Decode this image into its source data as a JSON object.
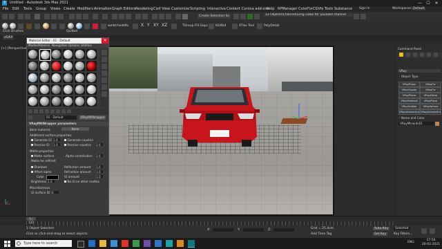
{
  "window": {
    "title": "Untitled - Autodesk 3ds Max 2021",
    "minimize": "—",
    "maximize": "☐",
    "close": "✕"
  },
  "menu": [
    "File",
    "Edit",
    "Tools",
    "Group",
    "Views",
    "Create",
    "Modifiers",
    "Animation",
    "Graph Editors",
    "Rendering",
    "Civil View",
    "Customize",
    "Scripting",
    "Interactive",
    "Content",
    "Corona add-ons",
    "Help",
    "RPManager",
    "ColorForCGVfx Tools",
    "Substance"
  ],
  "toolbar": {
    "selection_set": "Create Selection Se",
    "signin": "Sign In",
    "workspaces_label": "Workspaces:",
    "workspaces_value": "Default",
    "lineset_status": "Unsolved Camera Obj / Compressed",
    "lineset_info": "12 Objects\\Channel\\Long video for youtube channel",
    "view_label": "View",
    "click_brushes": "Click Brushes",
    "quilted": "Quilted",
    "rowby": "rowByAdd",
    "walkthrough": "walktrhee",
    "tilts": "tilts",
    "xyz": [
      "X",
      "Y",
      "XY",
      "XZ"
    ],
    "fill_gap": "Fill Gaps",
    "tgroup": "TGroup",
    "kill_label": "Kill/Kid",
    "camera_label": "Camera",
    "vray_label": "ATlas Tool",
    "polymodel": "PolyDetail",
    "texture": "Texture",
    "modeling": "Modeling",
    "freeform": "Freeform",
    "selection": "Selection",
    "object_paint": "Object Paint",
    "populate": "Populate"
  },
  "workspace_row": {
    "viewport_label": "[+] [Perspective] [S",
    "tab1": "VDRP",
    "tab2": "Modeling",
    "tab3": "Freeform"
  },
  "material_editor": {
    "title": "Material Editor - 01 - Default",
    "menu": [
      "Modes",
      "Material",
      "Navigation",
      "Options",
      "Utilities"
    ],
    "material_name": "01 - Default",
    "material_type": "VRayMtlWrapper",
    "rollout_title": "VRayMtlWrapper parameters",
    "base_material_label": "Base material:",
    "base_material_value": "None",
    "additional_props": "Additional surface properties",
    "generate_gi": "Generate GI",
    "generate_gi_val": "1.0",
    "receive_gi": "Receive GI",
    "receive_gi_val": "1.0",
    "generate_caustics": "Generate caustics",
    "receive_caustics": "Receive caustics",
    "receive_caustics_val": "1.0",
    "matte_props": "Matte properties",
    "matte_surface": "Matte surface",
    "alpha_contribution": "Alpha contribution",
    "alpha_val": "1.0",
    "matte_refl": "Matte for refl/refr",
    "shadows": "Shadows",
    "affect_alpha": "Affect alpha",
    "color_label": "Color",
    "brightness_label": "Brightness",
    "brightness_val": "1.0",
    "reflection_amount": "Reflection amount",
    "reflection_val": "1.0",
    "refraction_amount": "Refraction amount",
    "refraction_val": "1.0",
    "gi_amount": "GI amount",
    "gi_val": "1.0",
    "no_gi_matte": "No GI on other mattes",
    "misc": "Miscellaneous",
    "gi_surface_id": "GI surface ID",
    "gi_surface_id_val": "0"
  },
  "command_panel": {
    "title": "Command Panel",
    "dropdown": "VRay",
    "object_type": "Object Type",
    "name_color": "Name and Color",
    "object_name": "VRayMtrwrds01",
    "buttons": [
      "VRayProxy",
      "VRayFur",
      "VRayClipper",
      "VRayFur",
      "VRayPlane",
      "VRayDecal",
      "VRayMetaball",
      "VRayPlane",
      "VRayScatter",
      "VRaySphere",
      "VRayVolumeGrid",
      "VRayVolumeGrid",
      "ScanLine",
      "VRayMtlWrds"
    ]
  },
  "timeline": {
    "frame": "0 / 100",
    "ticks": [
      "0",
      "5",
      "10",
      "15",
      "20",
      "25",
      "30",
      "35",
      "40",
      "45",
      "50",
      "55",
      "60",
      "65",
      "70",
      "75",
      "80",
      "85",
      "90",
      "95",
      "100"
    ]
  },
  "status": {
    "selected": "1 Object Selected",
    "hint": "Click or click-and-drag to select objects",
    "x_label": "X:",
    "y_label": "Y:",
    "z_label": "Z:",
    "grid": "Grid = 25.4cm",
    "add_time_tag": "Add Time Tag",
    "auto_key": "Auto Key",
    "selected_mode": "Selected",
    "set_key": "Set Key",
    "key_filters": "Key Filters..."
  },
  "taskbar": {
    "search_placeholder": "Type here to search",
    "clock_time": "17:50",
    "clock_date": "26-02-2021",
    "lang": "ENG"
  },
  "colors": {
    "car_red": "#c8141c",
    "close_red": "#e81123",
    "accent_yellow": "#e8c020"
  }
}
